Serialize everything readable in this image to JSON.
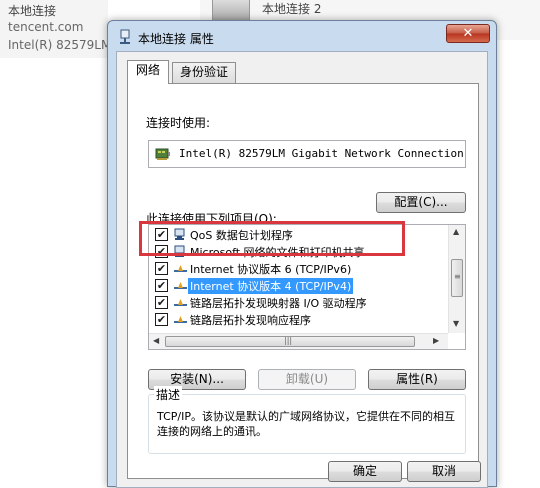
{
  "background": {
    "left_lines": [
      "本地连接",
      "tencent.com",
      "Intel(R) 82579LM"
    ],
    "right_line": "本地连接 2"
  },
  "window": {
    "title": "本地连接 属性",
    "close_glyph": "✕"
  },
  "tabs": [
    {
      "label": "网络",
      "active": true
    },
    {
      "label": "身份验证",
      "active": false
    }
  ],
  "connect_using_label": "连接时使用:",
  "adapter_name": "Intel(R) 82579LM Gigabit Network Connection",
  "configure_button": "配置(C)...",
  "items_label": "此连接使用下列项目(O):",
  "items": [
    {
      "label": "QoS 数据包计划程序",
      "checked": true,
      "icon": "qos-icon",
      "selected": false
    },
    {
      "label": "Microsoft 网络的文件和打印机共享",
      "checked": true,
      "icon": "file-share-icon",
      "selected": false
    },
    {
      "label": "Internet 协议版本 6 (TCP/IPv6)",
      "checked": true,
      "icon": "protocol-icon",
      "selected": false
    },
    {
      "label": "Internet 协议版本 4 (TCP/IPv4)",
      "checked": true,
      "icon": "protocol-icon",
      "selected": true
    },
    {
      "label": "链路层拓扑发现映射器 I/O 驱动程序",
      "checked": true,
      "icon": "protocol-icon",
      "selected": false
    },
    {
      "label": "链路层拓扑发现响应程序",
      "checked": true,
      "icon": "protocol-icon",
      "selected": false
    }
  ],
  "buttons": {
    "install": "安装(N)...",
    "uninstall": "卸载(U)",
    "properties": "属性(R)",
    "ok": "确定",
    "cancel": "取消"
  },
  "description": {
    "legend": "描述",
    "text": "TCP/IP。该协议是默认的广域网络协议，它提供在不同的相互连接的网络上的通讯。"
  },
  "colors": {
    "selection": "#3399ff",
    "highlight_box": "#d9363e"
  }
}
